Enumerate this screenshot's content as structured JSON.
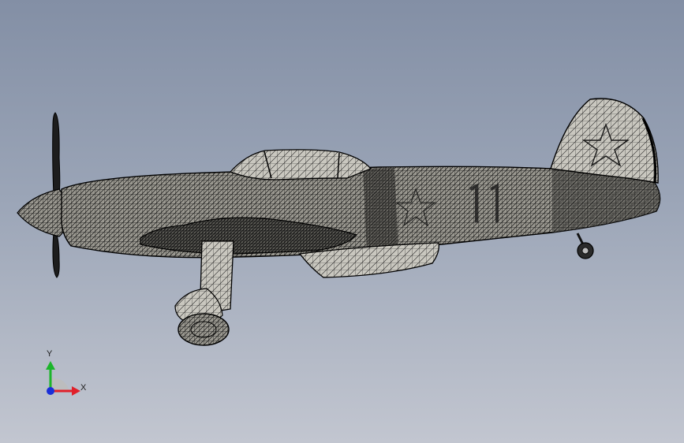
{
  "viewport": {
    "background_top": "#838fa5",
    "background_bottom": "#c2c6d0",
    "model": {
      "wireframe_color": "#111111",
      "surface_color": "#c8c6bd",
      "icon": "aircraft-model-icon"
    }
  },
  "triad": {
    "x_label": "X",
    "y_label": "Y",
    "x_color": "#e0202a",
    "y_color": "#1bb52a",
    "z_color": "#1a2fd8"
  }
}
